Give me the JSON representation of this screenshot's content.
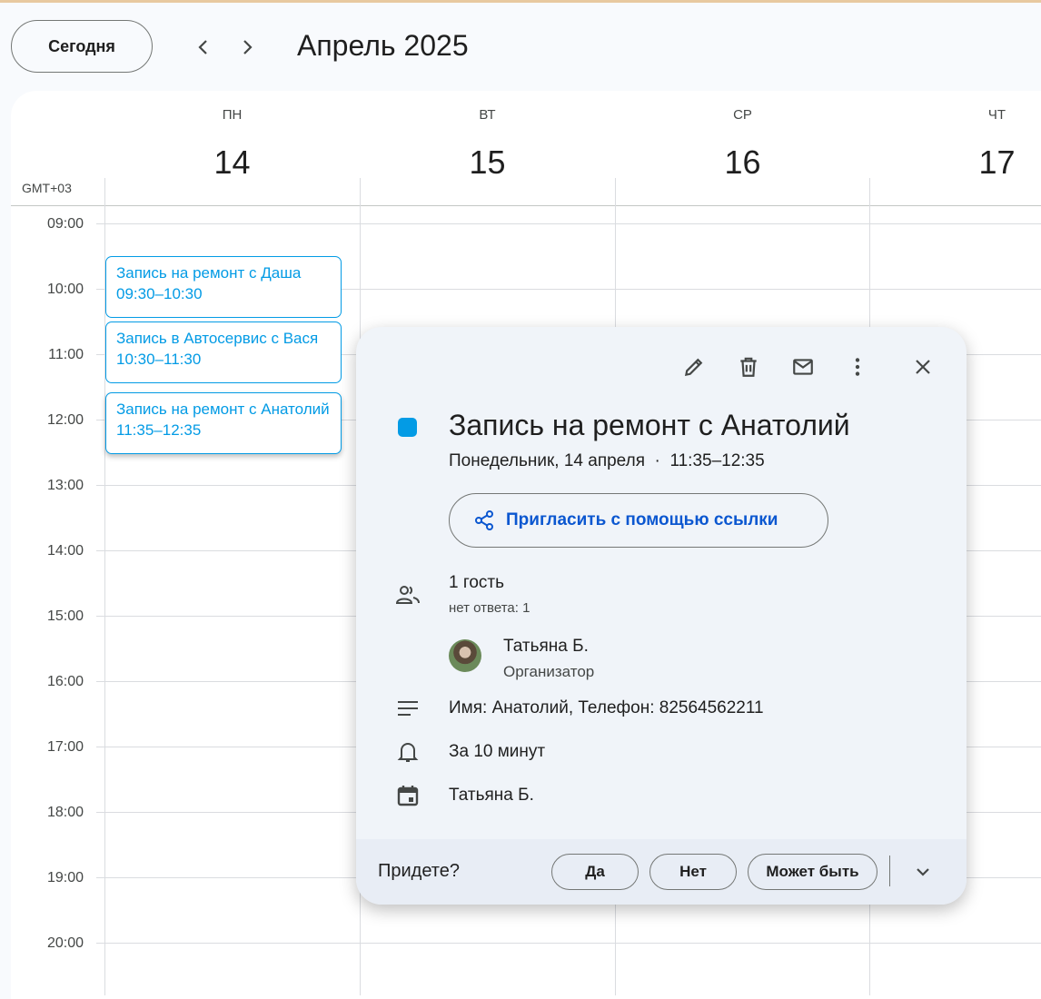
{
  "header": {
    "today_label": "Сегодня",
    "month_title": "Апрель 2025"
  },
  "calendar": {
    "timezone": "GMT+03",
    "days": [
      {
        "dow": "ПН",
        "num": "14"
      },
      {
        "dow": "ВТ",
        "num": "15"
      },
      {
        "dow": "СР",
        "num": "16"
      },
      {
        "dow": "ЧТ",
        "num": "17"
      }
    ],
    "hours": [
      "09:00",
      "10:00",
      "11:00",
      "12:00",
      "13:00",
      "14:00",
      "15:00",
      "16:00",
      "17:00",
      "18:00",
      "19:00",
      "20:00"
    ],
    "events": [
      {
        "title": "Запись на ремонт с Даша",
        "time": "09:30–10:30"
      },
      {
        "title": "Запись в Автосервис с Вася",
        "time": "10:30–11:30"
      },
      {
        "title": "Запись на ремонт с Анатолий",
        "time": "11:35–12:35"
      }
    ]
  },
  "popup": {
    "accent_color": "#039be5",
    "title": "Запись на ремонт с Анатолий",
    "date_line": "Понедельник, 14 апреля  ·  11:35–12:35",
    "invite_label": "Пригласить с помощью ссылки",
    "guests_count": "1 гость",
    "guests_status": "нет ответа: 1",
    "organizer_name": "Татьяна Б.",
    "organizer_role": "Организатор",
    "description": "Имя: Анатолий, Телефон: 82564562211",
    "reminder": "За 10 минут",
    "calendar_owner": "Татьяна Б.",
    "rsvp_question": "Придете?",
    "rsvp_yes": "Да",
    "rsvp_no": "Нет",
    "rsvp_maybe": "Может быть"
  }
}
